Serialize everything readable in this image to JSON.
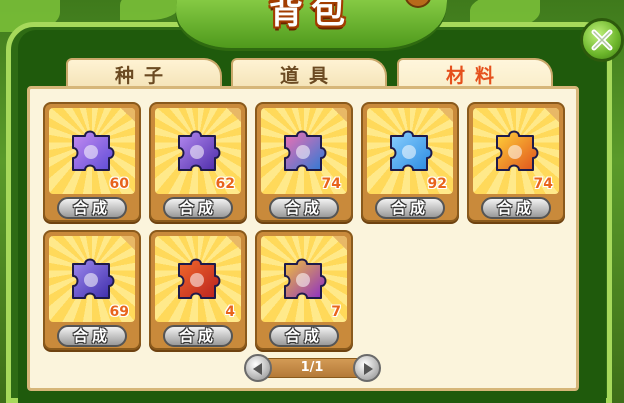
{
  "window": {
    "title": "背包"
  },
  "tabs": [
    {
      "label": "种子",
      "active": false
    },
    {
      "label": "道具",
      "active": false
    },
    {
      "label": "材料",
      "active": true
    }
  ],
  "items": [
    {
      "icon": "galaxy-puzzle-piece-icon",
      "count": "60",
      "action": "合成",
      "colors": [
        "#5b4bd6",
        "#c78cf2"
      ]
    },
    {
      "icon": "purple-figure-puzzle-piece-icon",
      "count": "62",
      "action": "合成",
      "colors": [
        "#4a2aa8",
        "#b58af0"
      ]
    },
    {
      "icon": "pink-drop-puzzle-piece-icon",
      "count": "74",
      "action": "合成",
      "colors": [
        "#2a7ad6",
        "#f26fb2"
      ]
    },
    {
      "icon": "anchor-puzzle-piece-icon",
      "count": "92",
      "action": "合成",
      "colors": [
        "#2a8ae0",
        "#8ad0ff"
      ]
    },
    {
      "icon": "flame-puzzle-piece-icon",
      "count": "74",
      "action": "合成",
      "colors": [
        "#e0501c",
        "#ffd23a"
      ]
    },
    {
      "icon": "figure-puzzle-piece-icon",
      "count": "69",
      "action": "合成",
      "colors": [
        "#3a2aa8",
        "#a08af0"
      ]
    },
    {
      "icon": "heart-puzzle-piece-icon",
      "count": "4",
      "action": "合成",
      "colors": [
        "#b82020",
        "#f26a2a"
      ]
    },
    {
      "icon": "purple-gem-puzzle-piece-icon",
      "count": "7",
      "action": "合成",
      "colors": [
        "#8a2ac8",
        "#f2c23a"
      ]
    }
  ],
  "pagination": {
    "text": "1/1"
  },
  "colors": {
    "accent": "#e5501c",
    "count": "#e8641c",
    "frame": "#a6d95b"
  }
}
